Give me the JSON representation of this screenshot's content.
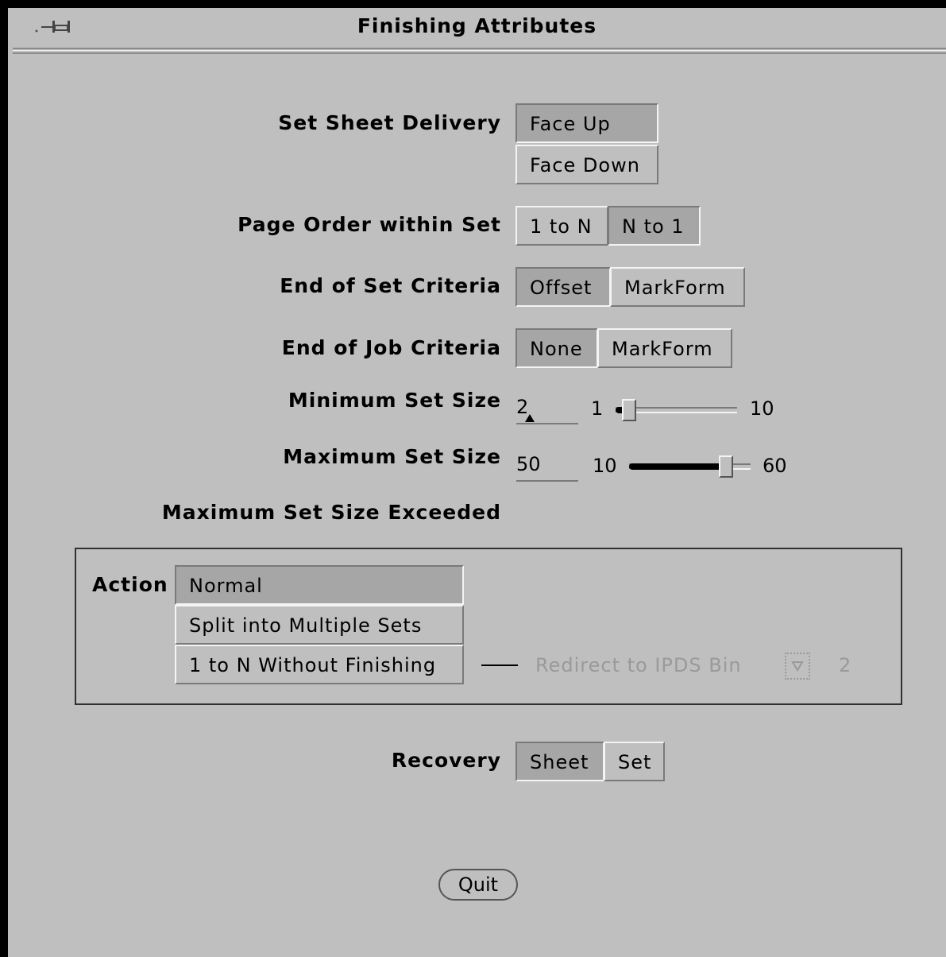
{
  "window": {
    "title": "Finishing Attributes"
  },
  "sheet_delivery": {
    "label": "Set Sheet Delivery",
    "options": [
      "Face Up",
      "Face Down"
    ],
    "selected": "Face Up"
  },
  "page_order": {
    "label": "Page Order within Set",
    "options": [
      "1 to N",
      "N to 1"
    ],
    "selected": "N to 1"
  },
  "end_of_set": {
    "label": "End of Set Criteria",
    "options": [
      "Offset",
      "MarkForm"
    ],
    "selected": "Offset"
  },
  "end_of_job": {
    "label": "End of Job Criteria",
    "options": [
      "None",
      "MarkForm"
    ],
    "selected": "None"
  },
  "min_set_size": {
    "label": "Minimum Set Size",
    "value": "2",
    "min": "1",
    "max": "10",
    "slider_fraction": 0.11
  },
  "max_set_size": {
    "label": "Maximum Set Size",
    "value": "50",
    "min": "10",
    "max": "60",
    "slider_fraction": 0.8
  },
  "exceeded": {
    "heading": "Maximum Set Size Exceeded",
    "action_label": "Action",
    "options": [
      "Normal",
      "Split into Multiple Sets",
      "1 to N Without Finishing"
    ],
    "selected": "Normal",
    "redirect_label": "Redirect to IPDS Bin",
    "redirect_value": "2"
  },
  "recovery": {
    "label": "Recovery",
    "options": [
      "Sheet",
      "Set"
    ],
    "selected": "Sheet"
  },
  "quit_label": "Quit"
}
